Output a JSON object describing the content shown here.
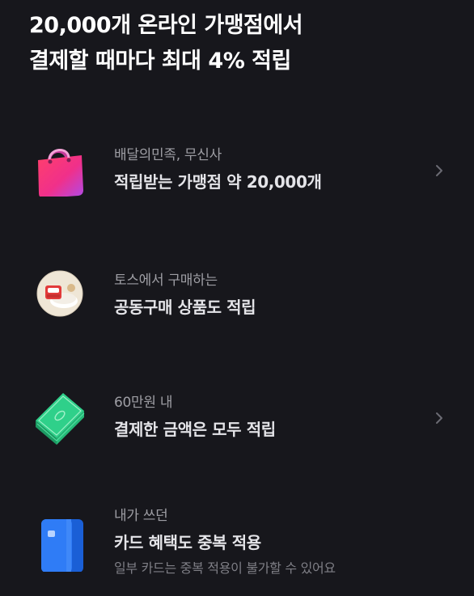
{
  "heading": {
    "line1": "20,000개 온라인 가맹점에서",
    "line2": "결제할 때마다 최대 4% 적립"
  },
  "rows": [
    {
      "icon": "shopping-bag-icon",
      "subtitle": "배달의민족, 무신사",
      "title": "적립받는 가맹점 약 20,000개",
      "has_chevron": true
    },
    {
      "icon": "group-buy-product-icon",
      "subtitle": "토스에서 구매하는",
      "title": "공동구매 상품도 적립",
      "has_chevron": false
    },
    {
      "icon": "money-stack-icon",
      "subtitle": "60만원 내",
      "title": "결제한 금액은 모두 적립",
      "has_chevron": true
    },
    {
      "icon": "card-icon",
      "subtitle": "내가 쓰던",
      "title": "카드 혜택도 중복 적용",
      "note": "일부 카드는 중복 적용이 불가할 수 있어요",
      "has_chevron": false
    }
  ],
  "colors": {
    "background": "#17171c",
    "title": "#ffffff",
    "subtitle": "#9e9ea4",
    "note": "#7f7f86",
    "chevron": "#6b6b73"
  }
}
